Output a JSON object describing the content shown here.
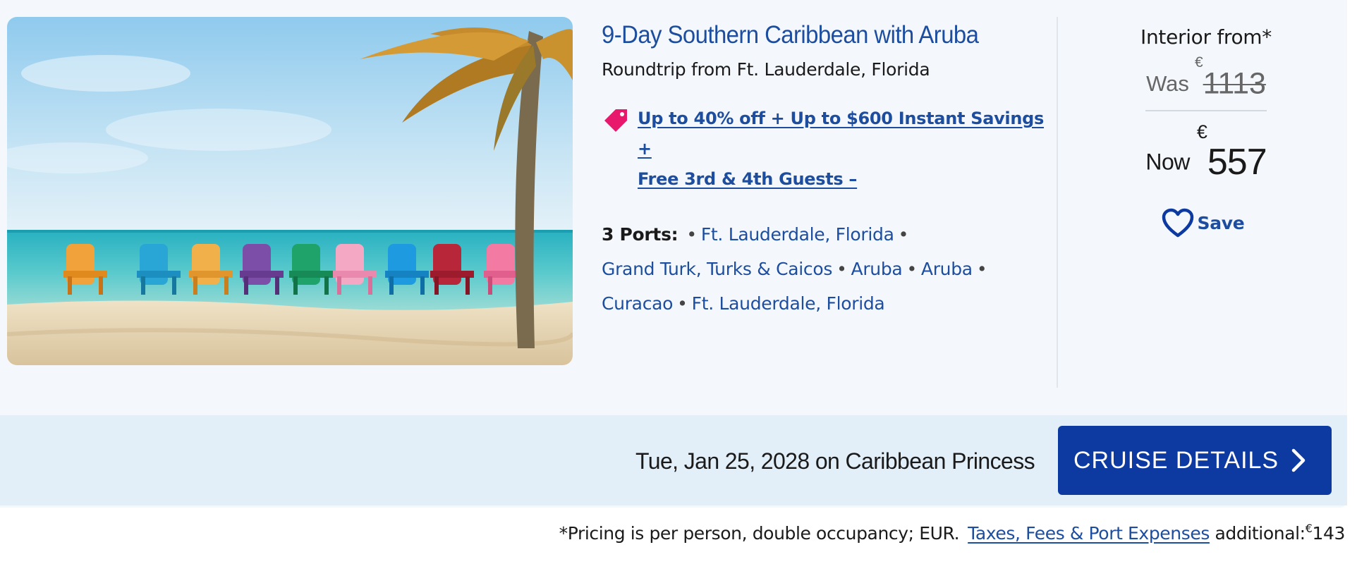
{
  "cruise": {
    "title": "9-Day Southern Caribbean with Aruba",
    "subtitle": "Roundtrip from Ft. Lauderdale, Florida",
    "promo_line1": "Up to 40% off + Up to $600 Instant Savings +",
    "promo_line2": "Free 3rd & 4th Guests –",
    "ports_label": "3 Ports:",
    "ports": [
      "Ft. Lauderdale, Florida",
      "Grand Turk, Turks & Caicos",
      "Aruba",
      "Aruba",
      "Curacao",
      "Ft. Lauderdale, Florida"
    ]
  },
  "pricing": {
    "interior_label": "Interior from*",
    "was_label": "Was",
    "currency": "€",
    "was_amount": "1113",
    "now_label": "Now",
    "now_amount": "557",
    "save_label": "Save"
  },
  "sailing": {
    "text": "Tue, Jan 25, 2028 on Caribbean Princess",
    "button_label": "CRUISE DETAILS"
  },
  "footnote": {
    "text": "*Pricing is per person, double occupancy; EUR.",
    "link_label": "Taxes, Fees & Port Expenses",
    "additional": "additional:",
    "currency": "€",
    "amount": "143"
  },
  "colors": {
    "link_blue": "#1d4d9e",
    "button_blue": "#0c3aa0",
    "promo_pink": "#e8186d",
    "card_bg": "#f4f8fc",
    "bar_bg": "#e2eef8"
  },
  "icons": {
    "promo": "price-tag-icon",
    "save": "heart-outline-icon",
    "details": "chevron-right-icon"
  }
}
